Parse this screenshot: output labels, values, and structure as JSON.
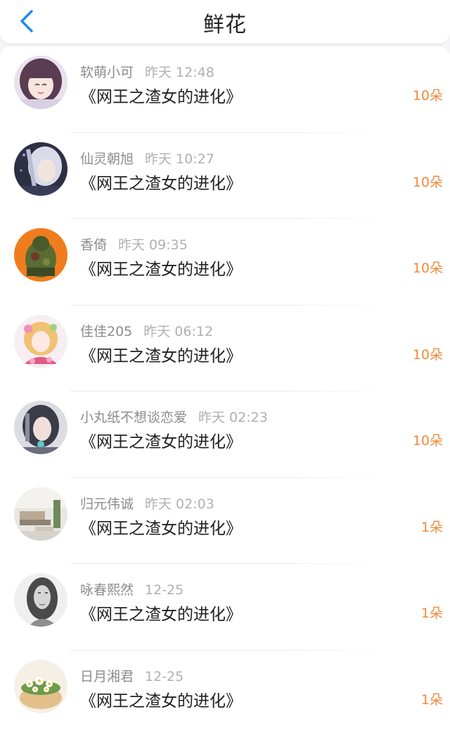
{
  "header": {
    "title": "鲜花"
  },
  "items": [
    {
      "name": "软萌小可",
      "time": "昨天 12:48",
      "book": "《网王之渣女的进化》",
      "count": "10朵",
      "avatar": "anime-girl-avatar"
    },
    {
      "name": "仙灵朝旭",
      "time": "昨天 10:27",
      "book": "《网王之渣女的进化》",
      "count": "10朵",
      "avatar": "anime-white-hair-avatar"
    },
    {
      "name": "香倚",
      "time": "昨天 09:35",
      "book": "《网王之渣女的进化》",
      "count": "10朵",
      "avatar": "green-monster-avatar"
    },
    {
      "name": "佳佳205",
      "time": "昨天 06:12",
      "book": "《网王之渣女的进化》",
      "count": "10朵",
      "avatar": "anime-pink-girl-avatar"
    },
    {
      "name": "小丸纸不想谈恋爱",
      "time": "昨天 02:23",
      "book": "《网王之渣女的进化》",
      "count": "10朵",
      "avatar": "anime-dark-hair-avatar"
    },
    {
      "name": "归元伟诚",
      "time": "昨天 02:03",
      "book": "《网王之渣女的进化》",
      "count": "1朵",
      "avatar": "room-interior-avatar"
    },
    {
      "name": "咏春熙然",
      "time": "12-25",
      "book": "《网王之渣女的进化》",
      "count": "1朵",
      "avatar": "bw-woman-avatar"
    },
    {
      "name": "日月湘君",
      "time": "12-25",
      "book": "《网王之渣女的进化》",
      "count": "1朵",
      "avatar": "daisy-bowl-avatar"
    }
  ],
  "colors": {
    "accent": "#1a8cf0",
    "count": "#ef8a3c"
  }
}
